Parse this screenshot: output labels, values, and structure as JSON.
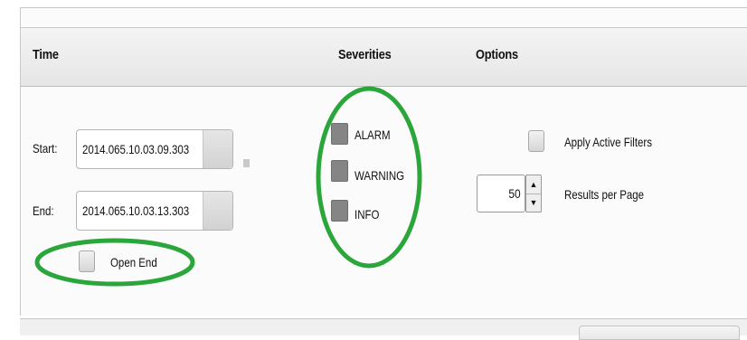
{
  "headers": {
    "time": "Time",
    "severities": "Severities",
    "options": "Options"
  },
  "time": {
    "start_label": "Start:",
    "start_value": "2014.065.10.03.09.303",
    "end_label": "End:",
    "end_value": "2014.065.10.03.13.303",
    "open_end_label": "Open End"
  },
  "severities": [
    {
      "label": "ALARM"
    },
    {
      "label": "WARNING"
    },
    {
      "label": "INFO"
    }
  ],
  "options": {
    "apply_filters_label": "Apply Active Filters",
    "results_value": "50",
    "results_label": "Results per Page"
  },
  "annotation_color": "#2aa63a",
  "icons": {
    "spinner_up": "triangle-up-icon",
    "spinner_down": "triangle-down-icon"
  }
}
